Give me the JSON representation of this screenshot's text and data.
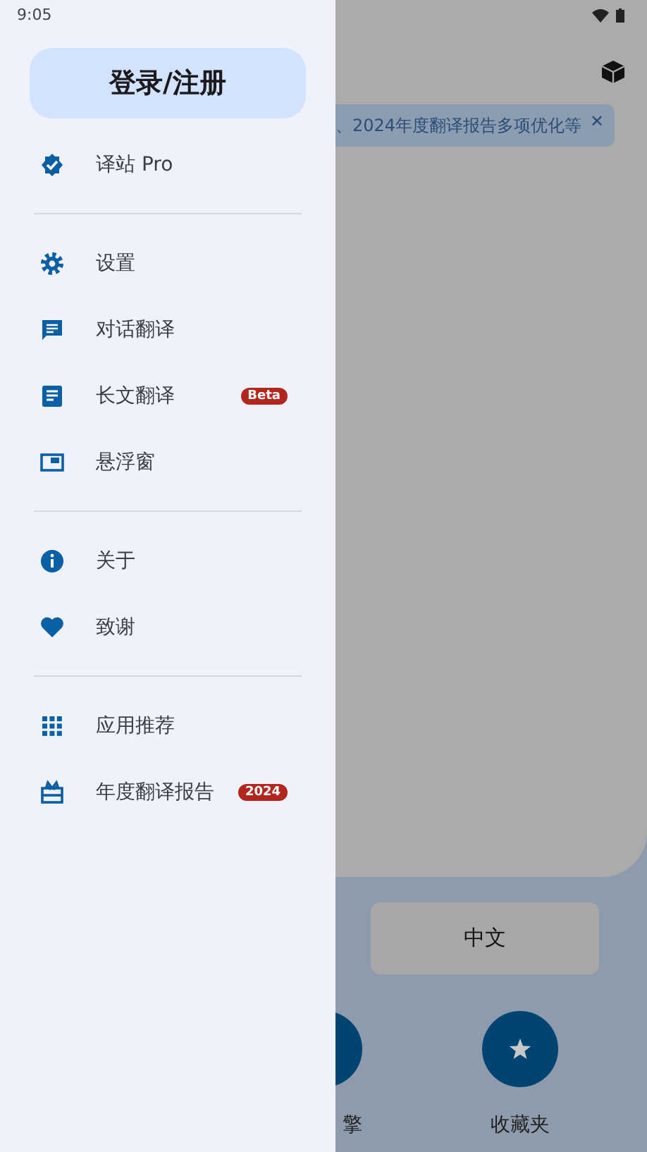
{
  "status_bar": {
    "time": "9:05"
  },
  "drawer": {
    "login_button": "登录/注册",
    "sections": [
      [
        {
          "label": "译站 Pro"
        }
      ],
      [
        {
          "label": "设置"
        },
        {
          "label": "对话翻译"
        },
        {
          "label": "长文翻译",
          "badge": "Beta"
        },
        {
          "label": "悬浮窗"
        }
      ],
      [
        {
          "label": "关于"
        },
        {
          "label": "致谢"
        }
      ],
      [
        {
          "label": "应用推荐"
        },
        {
          "label": "年度翻译报告",
          "badge": "2024"
        }
      ]
    ]
  },
  "background": {
    "banner": {
      "text": "、2024年度翻译报告多项优化等",
      "close": "✕"
    },
    "language_button": "中文",
    "actions": [
      {
        "label": "擎"
      },
      {
        "label": "收藏夹"
      }
    ]
  }
}
